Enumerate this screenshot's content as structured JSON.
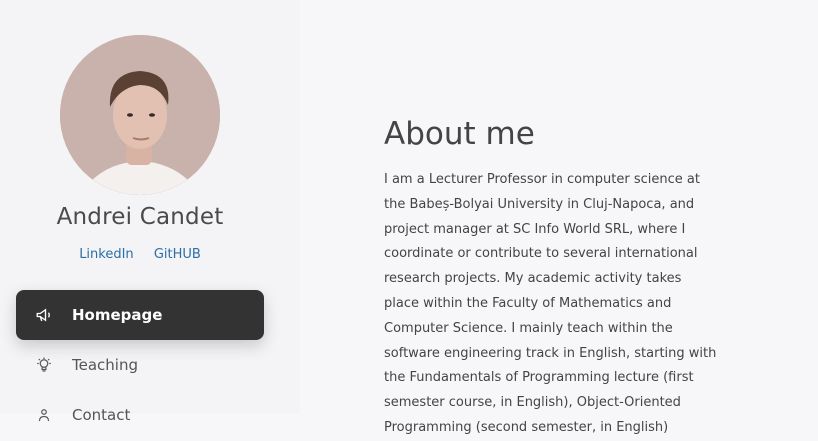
{
  "profile": {
    "name": "Andrei Candet",
    "links": [
      "LinkedIn",
      "GitHUB"
    ]
  },
  "nav": {
    "items": [
      {
        "label": "Homepage",
        "icon": "megaphone-icon",
        "active": true
      },
      {
        "label": "Teaching",
        "icon": "lightbulb-icon",
        "active": false
      },
      {
        "label": "Contact",
        "icon": "person-icon",
        "active": false
      }
    ]
  },
  "main": {
    "title": "About me",
    "body": "I am a Lecturer Professor in computer science at the Babeș-Bolyai University in Cluj-Napoca, and project manager at SC Info World SRL, where I coordinate or contribute to several international research projects. My academic activity takes place within the Faculty of Mathematics and Computer Science. I mainly teach within the software engineering track in English, starting with the Fundamentals of Programming lecture (first semester course, in English), Object-Oriented Programming (second semester, in English)"
  },
  "colors": {
    "active_nav_bg": "#333333",
    "link": "#2b6ea8",
    "page_bg": "#f7f7f9"
  }
}
